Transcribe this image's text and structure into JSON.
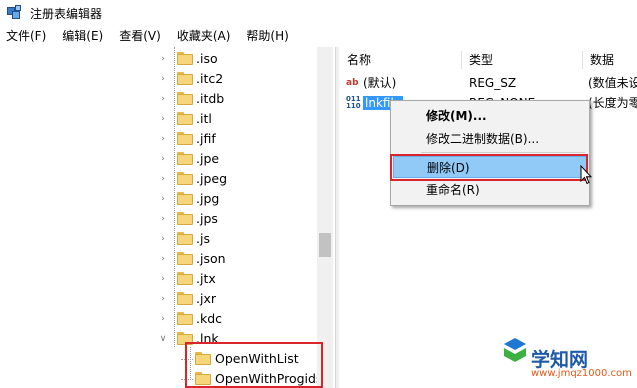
{
  "window": {
    "title": "注册表编辑器"
  },
  "menubar": [
    {
      "label": "文件(F)"
    },
    {
      "label": "编辑(E)"
    },
    {
      "label": "查看(V)"
    },
    {
      "label": "收藏夹(A)"
    },
    {
      "label": "帮助(H)"
    }
  ],
  "tree": {
    "items": [
      {
        "label": ".iso",
        "expanded": false
      },
      {
        "label": ".itc2",
        "expanded": false
      },
      {
        "label": ".itdb",
        "expanded": false
      },
      {
        "label": ".itl",
        "expanded": false
      },
      {
        "label": ".jfif",
        "expanded": false
      },
      {
        "label": ".jpe",
        "expanded": false
      },
      {
        "label": ".jpeg",
        "expanded": false
      },
      {
        "label": ".jpg",
        "expanded": false
      },
      {
        "label": ".jps",
        "expanded": false
      },
      {
        "label": ".js",
        "expanded": false
      },
      {
        "label": ".json",
        "expanded": false
      },
      {
        "label": ".jtx",
        "expanded": false
      },
      {
        "label": ".jxr",
        "expanded": false
      },
      {
        "label": ".kdc",
        "expanded": false
      },
      {
        "label": ".lnk",
        "expanded": true
      }
    ],
    "children": [
      {
        "label": "OpenWithList"
      },
      {
        "label": "OpenWithProgids"
      }
    ]
  },
  "values": {
    "columns": {
      "name": "名称",
      "type": "类型",
      "data": "数据"
    },
    "rows": [
      {
        "icon": "ab",
        "name": "(默认)",
        "type": "REG_SZ",
        "data": "(数值未设"
      },
      {
        "icon": "binary",
        "name": "lnkfile",
        "type": "REG_NONE",
        "data": "(长度为零"
      }
    ]
  },
  "context_menu": {
    "items": [
      {
        "label": "修改(M)...",
        "bold": true
      },
      {
        "label": "修改二进制数据(B)..."
      },
      {
        "label": "删除(D)",
        "hover": true
      },
      {
        "label": "重命名(R)"
      }
    ]
  },
  "watermark": {
    "title": "学知网",
    "url": "www.jmqz1000.com"
  },
  "colors": {
    "selection": "#3399ff",
    "menu_hover": "#91c9f7",
    "highlight_box": "#d9252b",
    "folder": "#f7d57a"
  }
}
